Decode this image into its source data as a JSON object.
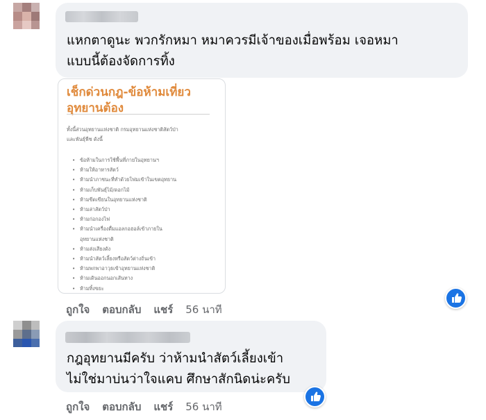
{
  "comments": [
    {
      "text_lines": [
        "แหกตาดูนะ พวกรักหมา หมาควรมีเจ้าของเมื่อพร้อม เจอหมา",
        "แบบนี้ต้องจัดการทิ้ง"
      ],
      "attachment": {
        "title_lines": [
          "เช็กด่วนกฎ-ข้อห้ามเที่ยว",
          "อุทยานต้อง"
        ],
        "intro_lines": [
          "ทั้งนี้ส่วนอุทยานแห่งชาติ กรมอุทยานแห่งชาติสัตว์ป่า",
          "และพันธุ์พืช ดังนี้"
        ],
        "rules": [
          "ข้อห้ามในการใช้พื้นที่ภายในอุทยานฯ",
          "ห้ามให้อาหารสัตว์",
          "ห้ามนำภาชนะที่ทำด้วยโฟมเข้าในเขตอุทยาน",
          "ห้ามเก็บพันธุ์ไม้/ดอกไม้",
          "ห้ามขีดเขียนในอุทยานแห่งชาติ",
          "ห้ามล่าสัตว์ป่า",
          "ห้ามก่อกองไฟ",
          "ห้ามนำเครื่องดื่มแอลกอฮอล์เข้าภายใน",
          "อุทยานแห่งชาติ",
          "ห้ามส่งเสียงดัง",
          "ห้ามนำสัตว์เลี้ยงหรือสัตว์ต่างถิ่นเข้า",
          "ห้ามพกพาอาวุธเข้าอุทยานแห่งชาติ",
          "ห้ามเดินออกนอกเส้นทาง",
          "ห้ามทิ้งขยะ"
        ]
      },
      "actions": {
        "like": "ถูกใจ",
        "reply": "ตอบกลับ",
        "share": "แชร์",
        "time": "56 นาที"
      }
    },
    {
      "text_lines": [
        "กฎอุทยานมีครับ ว่าห้ามนำสัตว์เลี้ยงเข้า",
        "ไม่ใช่มาบ่นว่าใจแคบ ศึกษาสักนิดน่ะครับ"
      ],
      "actions": {
        "like": "ถูกใจ",
        "reply": "ตอบกลับ",
        "share": "แชร์",
        "time": "56 นาที"
      }
    }
  ],
  "icons": {
    "reaction": "thumbs-up-icon"
  },
  "colors": {
    "bubble_bg": "#f0f2f5",
    "action_text": "#65676b",
    "card_title": "#e08a3c",
    "like_blue": "#1b74e4"
  }
}
